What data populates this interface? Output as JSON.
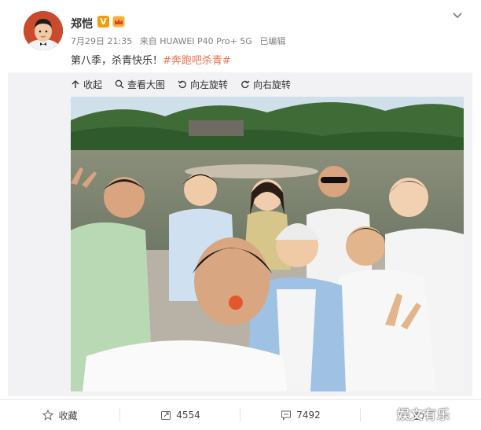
{
  "post": {
    "username": "郑恺",
    "verified_badge": "V",
    "timestamp": "7月29日 21:35",
    "source": "来自 HUAWEI P40 Pro+ 5G",
    "edited": "已编辑",
    "text": "第八季，杀青快乐！",
    "hashtag": "#奔跑吧杀青#"
  },
  "media_toolbar": {
    "collapse": "收起",
    "view_large": "查看大图",
    "rotate_left": "向左旋转",
    "rotate_right": "向右旋转"
  },
  "footer": {
    "favorite": "收藏",
    "repost_count": "4554",
    "comment_count": "7492",
    "like_count": ""
  },
  "watermark": "娱文有乐",
  "icons": {
    "menu": "chevron-down-icon",
    "badge": "crown-icon",
    "collapse": "collapse-arrow-icon",
    "view_large": "magnifier-icon",
    "rotate_left": "rotate-left-icon",
    "rotate_right": "rotate-right-icon",
    "favorite": "star-icon",
    "repost": "repost-icon",
    "comment": "comment-icon",
    "like": "thumb-up-icon"
  },
  "colors": {
    "hashtag": "#eb7350",
    "badge": "#f59b0b",
    "meta_text": "#808080"
  }
}
